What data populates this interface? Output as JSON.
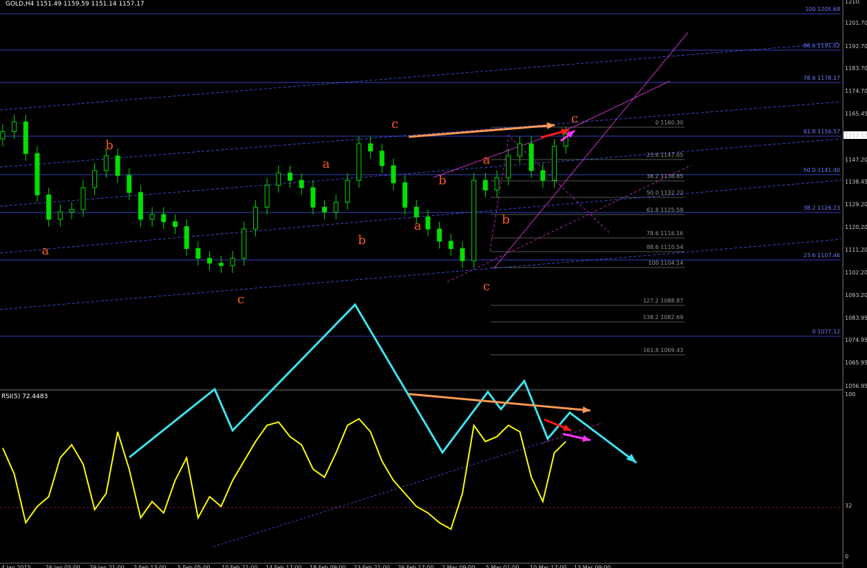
{
  "title": "GOLD,H4  1151.49 1159.59 1151.14 1157.17",
  "price_axis": [
    "1210.",
    "1201.70",
    "1192.70",
    "1183.70",
    "1174.70",
    "1165.45",
    "1157.17",
    "1147.20",
    "1138.45",
    "1129.20",
    "1120.20",
    "1111.20",
    "1102.20",
    "1093.20",
    "1083.95",
    "1074.95",
    "1065.95",
    "1056.95"
  ],
  "rsi_axis": [
    "100",
    "32",
    "0"
  ],
  "rsi_title": "RSI(5) 72.4483",
  "fib_blue": [
    "100 1205.68",
    "88.6 1191.02",
    "78.6 1178.17",
    "61.8 1156.57",
    "50.0 1141.40",
    "38.2 1126.23",
    "23.6 1107.46",
    "0 1077.12"
  ],
  "fib_gray": [
    "0 1160.30",
    "23.6 1147.05",
    "38.2 1138.85",
    "50.0 1132.22",
    "61.8 1125.59",
    "78.6 1116.16",
    "88.6 1110.54",
    "100 1104.14",
    "127.2 1088.87",
    "138.2 1082.69",
    "161.8 1069.43"
  ],
  "wave_labels": [
    "a",
    "b",
    "c",
    "a",
    "c",
    "b",
    "a",
    "b",
    "a",
    "c",
    "b",
    "c"
  ],
  "date_labels": [
    "4 Jan 2015",
    "26 Jan 05:00",
    "29 Jan 21:00",
    "2 Feb 13:00",
    "5 Feb 05:00",
    "10 Feb 21:00",
    "14 Feb 17:00",
    "18 Feb 09:00",
    "23 Feb 21:00",
    "26 Feb 17:00",
    "2 Mar 09:00",
    "5 Mar 01:00",
    "10 Mar 17:00",
    "13 Mar 09:00"
  ],
  "colors": {
    "candles": "#00e000",
    "fib_blue": "#4a5dff",
    "fib_gray": "#6f7a6f",
    "wave_labels": "#ff5a1f",
    "rsi_line": "#ffff00",
    "zigzag": "#3ee3ef",
    "trend_magenta": "#cc33cc",
    "arrow_orange": "#ff9955",
    "arrow_red": "#ff1a1a",
    "arrow_magenta": "#ff33ff",
    "level_32": "#b03060"
  },
  "chart_data": {
    "type": "line",
    "title": "GOLD,H4",
    "price_close": [
      1158,
      1162,
      1149,
      1132,
      1122,
      1125,
      1126,
      1135,
      1142,
      1148,
      1140,
      1133,
      1122,
      1124,
      1121,
      1119,
      1110,
      1106,
      1104,
      1103,
      1106,
      1118,
      1127,
      1136,
      1141,
      1138,
      1135,
      1127,
      1125,
      1129,
      1138,
      1153,
      1150,
      1144,
      1137,
      1127,
      1123,
      1118,
      1113,
      1110,
      1105,
      1138,
      1134,
      1139,
      1148,
      1153,
      1142,
      1138,
      1152,
      1157
    ],
    "rsi_values": [
      68,
      52,
      22,
      32,
      38,
      62,
      70,
      58,
      30,
      40,
      78,
      55,
      25,
      35,
      28,
      48,
      62,
      25,
      38,
      32,
      48,
      60,
      72,
      82,
      84,
      75,
      70,
      55,
      50,
      65,
      82,
      86,
      78,
      60,
      48,
      40,
      32,
      28,
      22,
      18,
      40,
      82,
      72,
      75,
      82,
      78,
      50,
      35,
      65,
      72
    ],
    "rsi_ylim": [
      0,
      100
    ],
    "rsi_level": 32,
    "price_ylim": [
      1052,
      1212
    ]
  }
}
